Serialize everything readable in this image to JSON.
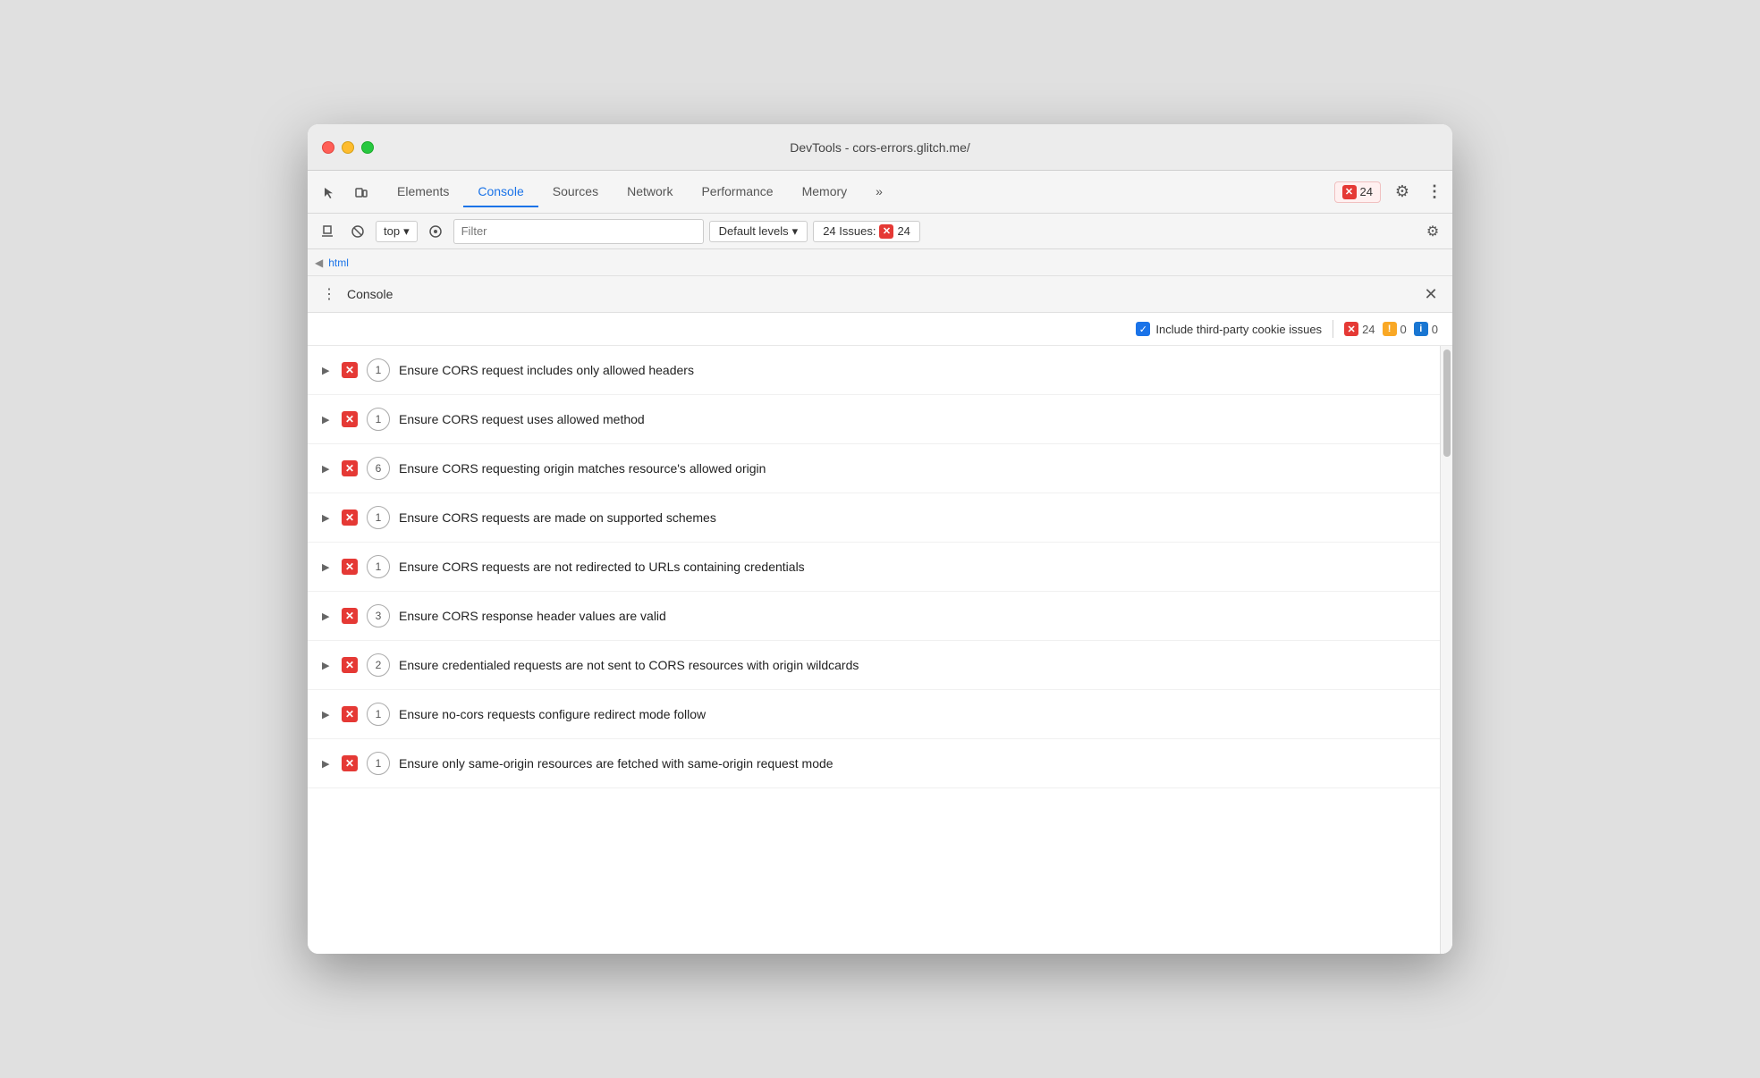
{
  "window": {
    "title": "DevTools - cors-errors.glitch.me/"
  },
  "toolbar": {
    "tabs": [
      {
        "label": "Elements",
        "active": false
      },
      {
        "label": "Console",
        "active": true
      },
      {
        "label": "Sources",
        "active": false
      },
      {
        "label": "Network",
        "active": false
      },
      {
        "label": "Performance",
        "active": false
      },
      {
        "label": "Memory",
        "active": false
      }
    ],
    "more_label": "»",
    "error_count": "24"
  },
  "console_toolbar": {
    "filter_placeholder": "Filter",
    "context_label": "top",
    "levels_label": "Default levels",
    "issues_label": "24 Issues:",
    "issues_count": "24"
  },
  "breadcrumb": {
    "arrow": "◀",
    "html_text": "html"
  },
  "issues_panel": {
    "title": "Console",
    "include_cookie_label": "Include third-party cookie issues",
    "error_count": "24",
    "warning_count": "0",
    "info_count": "0",
    "items": [
      {
        "text": "Ensure CORS request includes only allowed headers",
        "count": "1"
      },
      {
        "text": "Ensure CORS request uses allowed method",
        "count": "1"
      },
      {
        "text": "Ensure CORS requesting origin matches resource's allowed origin",
        "count": "6"
      },
      {
        "text": "Ensure CORS requests are made on supported schemes",
        "count": "1"
      },
      {
        "text": "Ensure CORS requests are not redirected to URLs containing credentials",
        "count": "1"
      },
      {
        "text": "Ensure CORS response header values are valid",
        "count": "3"
      },
      {
        "text": "Ensure credentialed requests are not sent to CORS resources with origin wildcards",
        "count": "2"
      },
      {
        "text": "Ensure no-cors requests configure redirect mode follow",
        "count": "1"
      },
      {
        "text": "Ensure only same-origin resources are fetched with same-origin request mode",
        "count": "1"
      }
    ]
  }
}
